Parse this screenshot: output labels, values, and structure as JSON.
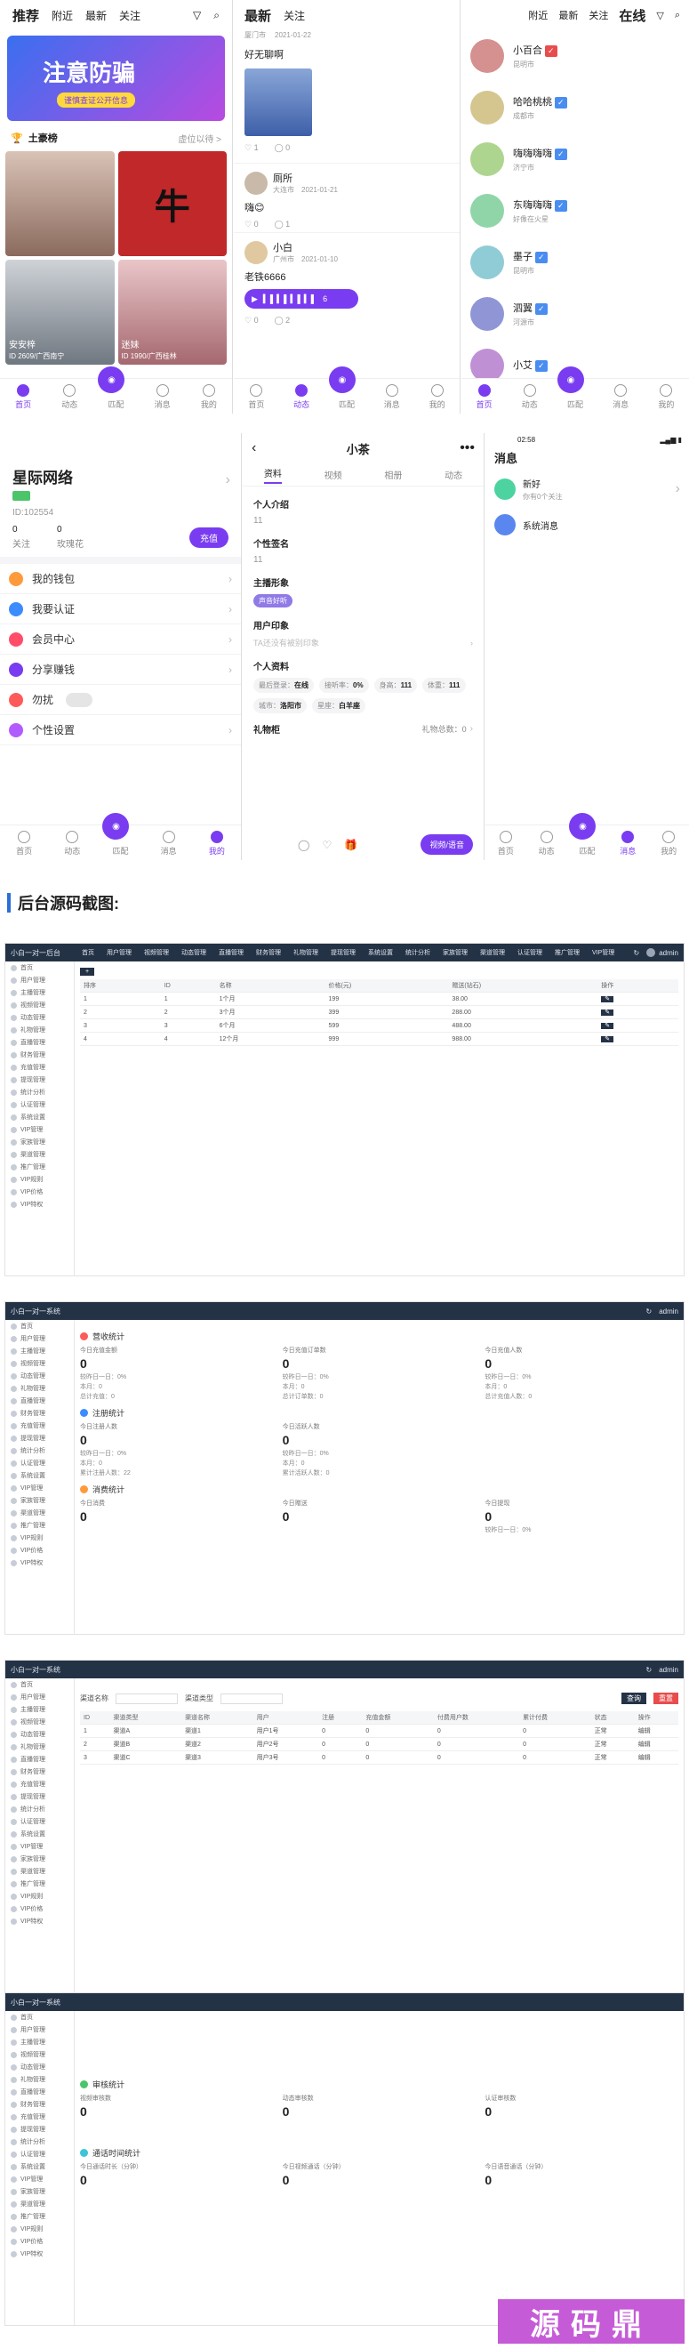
{
  "feed": {
    "tabs": [
      "推荐",
      "附近",
      "最新",
      "关注"
    ],
    "banner_title": "注意防骗",
    "banner_sub": "谨慎查证公开信息",
    "rank_title": "土豪榜",
    "rank_more": "虚位以待 >",
    "cards": [
      {
        "name": "安安梓",
        "info": "ID 2609/广西南宁"
      },
      {
        "name": "迷妹",
        "info": "ID 1990/广西桂林"
      }
    ],
    "tabbar": [
      "首页",
      "动态",
      "匹配",
      "消息",
      "我的"
    ]
  },
  "moments": {
    "tabs": [
      "最新",
      "关注"
    ],
    "posts": [
      {
        "name": "",
        "loc": "厦门市",
        "date": "2021-01-22",
        "text": "好无聊啊",
        "likes": "1",
        "comments": "0"
      },
      {
        "name": "厕所",
        "loc": "大连市",
        "date": "2021-01-21",
        "text": "嗨😊",
        "likes": "0",
        "comments": "1"
      },
      {
        "name": "小白",
        "loc": "广州市",
        "date": "2021-01-10",
        "text": "老铁6666",
        "voice": "6",
        "likes": "0",
        "comments": "2"
      }
    ],
    "tabbar": [
      "首页",
      "动态",
      "匹配",
      "消息",
      "我的"
    ]
  },
  "online": {
    "tabs": [
      "附近",
      "最新",
      "关注",
      "在线"
    ],
    "users": [
      {
        "name": "小百合",
        "sub": "昆明市",
        "color": "#e94c4c"
      },
      {
        "name": "哈哈桃桃",
        "sub": "成都市",
        "color": "#4a8df0"
      },
      {
        "name": "嗨嗨嗨嗨",
        "sub": "济宁市",
        "color": "#4a8df0"
      },
      {
        "name": "东嗨嗨嗨",
        "sub": "好像在火星",
        "color": "#4a8df0"
      },
      {
        "name": "墨子",
        "sub": "昆明市",
        "color": "#4a8df0"
      },
      {
        "name": "泗翼",
        "sub": "河源市",
        "color": "#4a8df0"
      },
      {
        "name": "小艾",
        "sub": "",
        "color": "#4a8df0"
      }
    ],
    "tabbar": [
      "首页",
      "动态",
      "匹配",
      "消息",
      "我的"
    ]
  },
  "profile": {
    "name": "星际网络",
    "id": "ID:102554",
    "follow_count": "0",
    "follow_label": "关注",
    "rose_count": "0",
    "rose_label": "玫瑰花",
    "recharge": "充值",
    "menu": [
      "我的钱包",
      "我要认证",
      "会员中心",
      "分享赚钱",
      "勿扰",
      "个性设置"
    ],
    "tabbar": [
      "首页",
      "动态",
      "匹配",
      "消息",
      "我的"
    ]
  },
  "detail": {
    "title": "小茶",
    "tabs": [
      "资料",
      "视频",
      "相册",
      "动态"
    ],
    "intro_label": "个人介绍",
    "intro": "11",
    "sign_label": "个性签名",
    "sign": "11",
    "style_label": "主播形象",
    "style_tag": "声音好听",
    "impression_label": "用户印象",
    "impression": "TA还没有被别印象",
    "info_label": "个人资料",
    "info": [
      {
        "k": "最后登录：",
        "v": "在线"
      },
      {
        "k": "接听率：",
        "v": "0%"
      },
      {
        "k": "身高：",
        "v": "111"
      },
      {
        "k": "体重：",
        "v": "111"
      },
      {
        "k": "城市：",
        "v": "洛阳市"
      },
      {
        "k": "星座：",
        "v": "白羊座"
      }
    ],
    "gift_label": "礼物柜",
    "gift_count": "礼物总数：0",
    "call_btn": "视频/语音"
  },
  "messages": {
    "time": "02:58",
    "title": "消息",
    "items": [
      {
        "name": "新好",
        "sub": "你有0个关注",
        "color": "#4cd3a0"
      },
      {
        "name": "系统消息",
        "sub": "",
        "color": "#5a86f0"
      }
    ],
    "tabbar": [
      "首页",
      "动态",
      "匹配",
      "消息",
      "我的"
    ]
  },
  "section_title": "后台源码截图:",
  "admin1": {
    "brand": "小白一对一后台",
    "nav": [
      "首页",
      "用户管理",
      "视频管理",
      "动态管理",
      "直播管理",
      "财务管理",
      "礼物管理",
      "提现管理",
      "系统设置",
      "统计分析",
      "家族管理",
      "渠道管理",
      "认证管理",
      "推广管理",
      "VIP管理"
    ],
    "user": "admin",
    "side": [
      "首页",
      "用户管理",
      "主播管理",
      "视频管理",
      "动态管理",
      "礼物管理",
      "直播管理",
      "财务管理",
      "充值管理",
      "提现管理",
      "统计分析",
      "认证管理",
      "系统设置",
      "VIP管理",
      "家族管理",
      "渠道管理",
      "推广管理",
      "VIP规则",
      "VIP价格",
      "VIP特权"
    ],
    "table_head": [
      "排序",
      "ID",
      "名称",
      "价格(元)",
      "赠送(钻石)",
      "操作"
    ],
    "rows": [
      [
        "1",
        "1",
        "1个月",
        "199",
        "38.00"
      ],
      [
        "2",
        "2",
        "3个月",
        "399",
        "288.00"
      ],
      [
        "3",
        "3",
        "6个月",
        "599",
        "488.00"
      ],
      [
        "4",
        "4",
        "12个月",
        "999",
        "988.00"
      ]
    ]
  },
  "admin2": {
    "brand": "小白一对一系统",
    "user": "admin",
    "sec1": "营收统计",
    "sec1_cells": [
      {
        "l": "今日充值金额",
        "v": "0",
        "s": [
          "较昨日一日：0%",
          "本月：0",
          "总计充值：0"
        ]
      },
      {
        "l": "今日充值订单数",
        "v": "0",
        "s": [
          "较昨日一日：0%",
          "本月：0",
          "总计订单数：0"
        ]
      },
      {
        "l": "今日充值人数",
        "v": "0",
        "s": [
          "较昨日一日：0%",
          "本月：0",
          "总计充值人数：0"
        ]
      }
    ],
    "sec2": "注册统计",
    "sec2_cells": [
      {
        "l": "今日注册人数",
        "v": "0",
        "s": [
          "较昨日一日：0%",
          "本月：0",
          "累计注册人数：22"
        ]
      },
      {
        "l": "今日活跃人数",
        "v": "0",
        "s": [
          "较昨日一日：0%",
          "本月：0",
          "累计活跃人数：0"
        ]
      }
    ],
    "sec3": "消费统计",
    "sec3_cells": [
      {
        "l": "今日消费",
        "v": "0",
        "s": []
      },
      {
        "l": "今日赠送",
        "v": "0",
        "s": []
      },
      {
        "l": "今日提现",
        "v": "0",
        "s": [
          "较昨日一日：0%"
        ]
      }
    ]
  },
  "admin3": {
    "brand": "小白一对一系统",
    "user": "admin",
    "filters": [
      "渠道名称",
      "渠道类型",
      "查询",
      "重置"
    ],
    "table_head": [
      "ID",
      "渠道类型",
      "渠道名称",
      "用户",
      "注册",
      "充值金额",
      "付费用户数",
      "累计付费",
      "状态",
      "操作"
    ],
    "rows": [
      [
        "1",
        "渠道A",
        "渠道1",
        "用户1号",
        "0",
        "0",
        "0",
        "0",
        "正常",
        "编辑"
      ],
      [
        "2",
        "渠道B",
        "渠道2",
        "用户2号",
        "0",
        "0",
        "0",
        "0",
        "正常",
        "编辑"
      ],
      [
        "3",
        "渠道C",
        "渠道3",
        "用户3号",
        "0",
        "0",
        "0",
        "0",
        "正常",
        "编辑"
      ]
    ]
  },
  "admin4": {
    "brand": "小白一对一系统",
    "sec1": "审核统计",
    "sec2": "通话时间统计",
    "cells_a": [
      {
        "l": "视频审核数",
        "v": "0"
      },
      {
        "l": "动态审核数",
        "v": "0"
      },
      {
        "l": "认证审核数",
        "v": "0"
      }
    ],
    "cells_b": [
      {
        "l": "今日通话时长（分钟）",
        "v": "0"
      },
      {
        "l": "今日视频通话（分钟）",
        "v": "0"
      },
      {
        "l": "今日语音通话（分钟）",
        "v": "0"
      }
    ]
  },
  "watermark": "源码鼎"
}
